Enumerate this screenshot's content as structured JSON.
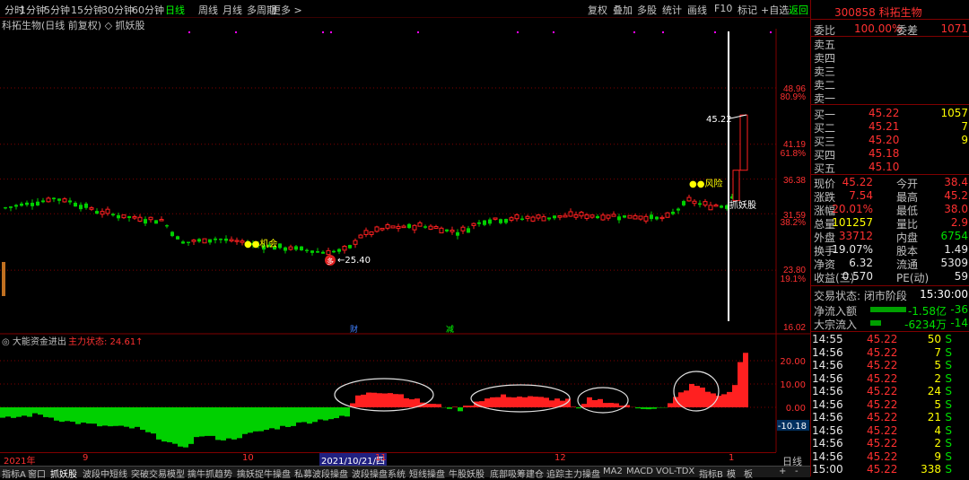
{
  "toolbar": {
    "left_items": [
      "分时",
      "1分钟",
      "5分钟",
      "15分钟",
      "30分钟",
      "60分钟",
      "日线",
      "周线",
      "月线",
      "多周期",
      "更多 >"
    ],
    "right_items": [
      "复权",
      "叠加",
      "多股",
      "统计",
      "画线",
      "F10",
      "标记",
      "+自选",
      "返回"
    ]
  },
  "chart": {
    "title": "科拓生物(日线 前复权) ◇ 抓妖股",
    "price_labels": [
      "48.96",
      "80.9%",
      "41.19",
      "61.8%",
      "36.38",
      "31.59",
      "38.2%",
      "23.80",
      "19.1%",
      "16.02"
    ],
    "annotations": {
      "opportunity": "●●机会",
      "risk": "●●风险",
      "low_marker": "←25.40",
      "high_marker": "45.22",
      "catch_label": "抓妖股",
      "low_badge": "多",
      "event1": "财",
      "event2": "减"
    }
  },
  "subchart": {
    "title": "◎ 大能资金进出",
    "status": "主力状态: 24.61↑",
    "axis": [
      "20.00",
      "10.00",
      "0.00"
    ],
    "current_value": "-10.18"
  },
  "x_axis": {
    "labels": [
      "2021年",
      "9",
      "10",
      "2021/10/21/四",
      "11",
      "12",
      "1"
    ],
    "period": "日线"
  },
  "bottom_tabs": [
    "指标A",
    "窗口",
    "抓妖股",
    "波段中短线",
    "突破交易模型",
    "擒牛抓趋势",
    "擒妖捉牛操盘",
    "私募波段操盘",
    "波段操盘系统",
    "短线操盘",
    "牛股妖股",
    "底部吸筹建仓",
    "追踪主力操盘",
    "MA2",
    "MACD",
    "VOL-TDX",
    "指标B",
    "模",
    "板",
    "+",
    "-"
  ],
  "stock": {
    "code_name": "300858 科拓生物",
    "weibi_label": "委比",
    "weibi": "100.00%",
    "weicha_label": "委差",
    "weicha": "1071",
    "sell": [
      {
        "l": "卖五",
        "p": "",
        "v": ""
      },
      {
        "l": "卖四",
        "p": "",
        "v": ""
      },
      {
        "l": "卖三",
        "p": "",
        "v": ""
      },
      {
        "l": "卖二",
        "p": "",
        "v": ""
      },
      {
        "l": "卖一",
        "p": "",
        "v": ""
      }
    ],
    "buy": [
      {
        "l": "买一",
        "p": "45.22",
        "v": "1057"
      },
      {
        "l": "买二",
        "p": "45.21",
        "v": "7"
      },
      {
        "l": "买三",
        "p": "45.20",
        "v": "9"
      },
      {
        "l": "买四",
        "p": "45.18",
        "v": ""
      },
      {
        "l": "买五",
        "p": "45.10",
        "v": ""
      }
    ],
    "stats": [
      {
        "l1": "现价",
        "v1": "45.22",
        "l2": "今开",
        "v2": "38.4",
        "c1": "red",
        "c2": "red"
      },
      {
        "l1": "涨跌",
        "v1": "7.54",
        "l2": "最高",
        "v2": "45.2",
        "c1": "red",
        "c2": "red"
      },
      {
        "l1": "涨幅",
        "v1": "20.01%",
        "l2": "最低",
        "v2": "38.0",
        "c1": "red",
        "c2": "red"
      },
      {
        "l1": "总量",
        "v1": "101257",
        "l2": "量比",
        "v2": "2.9",
        "c1": "yellow",
        "c2": "red"
      },
      {
        "l1": "外盘",
        "v1": "33712",
        "l2": "内盘",
        "v2": "6754",
        "c1": "red",
        "c2": "green"
      },
      {
        "l1": "换手",
        "v1": "19.07%",
        "l2": "股本",
        "v2": "1.49",
        "c1": "white",
        "c2": "white"
      },
      {
        "l1": "净资",
        "v1": "6.32",
        "l2": "流通",
        "v2": "5309",
        "c1": "white",
        "c2": "white"
      },
      {
        "l1": "收益(三)",
        "v1": "0.570",
        "l2": "PE(动)",
        "v2": "59",
        "c1": "white",
        "c2": "white"
      }
    ],
    "status_label": "交易状态: 闭市阶段",
    "status_time": "15:30:00",
    "netflow_label": "净流入额",
    "netflow_value": "-1.58亿",
    "netflow_value2": "-36",
    "block_label": "大宗流入",
    "block_value": "-6234万",
    "block_value2": "-14",
    "ticks": [
      {
        "t": "14:55",
        "p": "45.22",
        "v": "50",
        "d": "S"
      },
      {
        "t": "14:56",
        "p": "45.22",
        "v": "7",
        "d": "S"
      },
      {
        "t": "14:56",
        "p": "45.22",
        "v": "5",
        "d": "S"
      },
      {
        "t": "14:56",
        "p": "45.22",
        "v": "2",
        "d": "S"
      },
      {
        "t": "14:56",
        "p": "45.22",
        "v": "24",
        "d": "S"
      },
      {
        "t": "14:56",
        "p": "45.22",
        "v": "5",
        "d": "S"
      },
      {
        "t": "14:56",
        "p": "45.22",
        "v": "21",
        "d": "S"
      },
      {
        "t": "14:56",
        "p": "45.22",
        "v": "4",
        "d": "S"
      },
      {
        "t": "14:56",
        "p": "45.22",
        "v": "2",
        "d": "S"
      },
      {
        "t": "14:56",
        "p": "45.22",
        "v": "9",
        "d": "S"
      },
      {
        "t": "15:00",
        "p": "45.22",
        "v": "338",
        "d": "S"
      }
    ]
  },
  "colors": {
    "up": "#ff2020",
    "down": "#00d000",
    "axis": "#800000",
    "pink": "#ff00ff"
  }
}
